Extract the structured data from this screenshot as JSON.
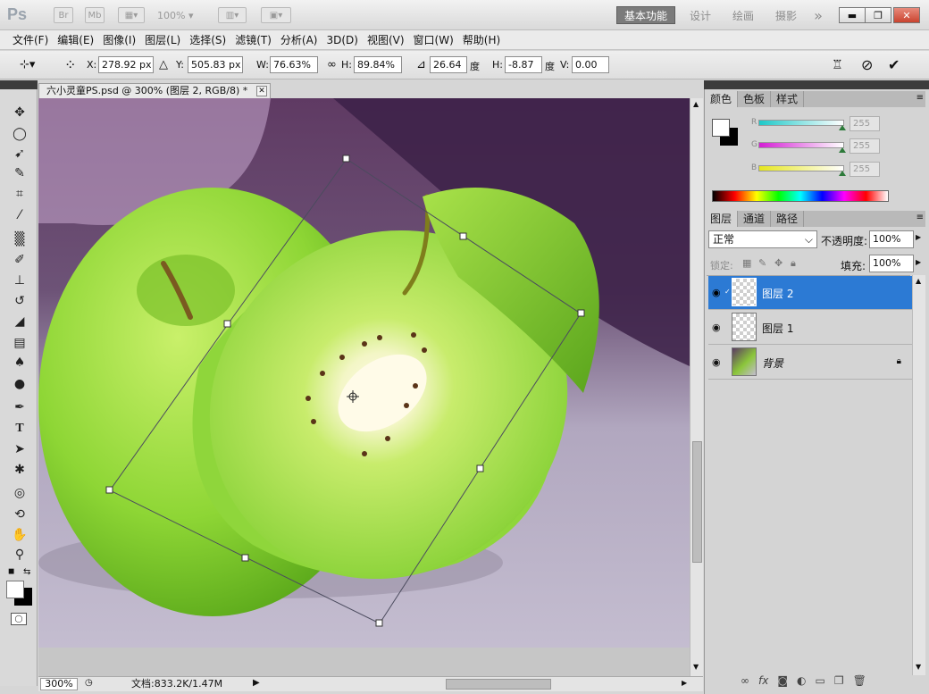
{
  "app": {
    "logo": "Ps",
    "buttons": [
      "Br",
      "Mb"
    ],
    "zoom_combo": "100%",
    "workspaces": [
      "基本功能",
      "设计",
      "绘画",
      "摄影"
    ],
    "more": "»",
    "window_controls": [
      "▬",
      "❐",
      "✕"
    ]
  },
  "menu": [
    "文件(F)",
    "编辑(E)",
    "图像(I)",
    "图层(L)",
    "选择(S)",
    "滤镜(T)",
    "分析(A)",
    "3D(D)",
    "视图(V)",
    "窗口(W)",
    "帮助(H)"
  ],
  "options": {
    "x_label": "X:",
    "x_value": "278.92 px",
    "y_label": "Y:",
    "y_value": "505.83 px",
    "w_label": "W:",
    "w_value": "76.63%",
    "h_label": "H:",
    "h_value": "89.84%",
    "angle_value": "26.64",
    "angle_unit": "度",
    "hskew_label": "H:",
    "hskew_value": "-8.87",
    "hskew_unit": "度",
    "vskew_label": "V:",
    "vskew_value": "0.00"
  },
  "document": {
    "tab_title": "六小灵童PS.psd @ 300% (图层 2, RGB/8) *",
    "zoom": "300%",
    "doc_info": "文档:833.2K/1.47M"
  },
  "color_panel": {
    "tabs": [
      "颜色",
      "色板",
      "样式"
    ],
    "channels": [
      {
        "label": "R",
        "value": "255",
        "color": "#1ec8c8"
      },
      {
        "label": "G",
        "value": "255",
        "color": "#d41ed4"
      },
      {
        "label": "B",
        "value": "255",
        "color": "#e6e61e"
      }
    ]
  },
  "layers_panel": {
    "tabs": [
      "图层",
      "通道",
      "路径"
    ],
    "blend_mode": "正常",
    "opacity_label": "不透明度:",
    "opacity_value": "100%",
    "lock_label": "锁定:",
    "fill_label": "填充:",
    "fill_value": "100%",
    "layers": [
      {
        "name": "图层 2",
        "selected": true
      },
      {
        "name": "图层 1",
        "selected": false
      },
      {
        "name": "背景",
        "selected": false,
        "locked": true
      }
    ]
  }
}
